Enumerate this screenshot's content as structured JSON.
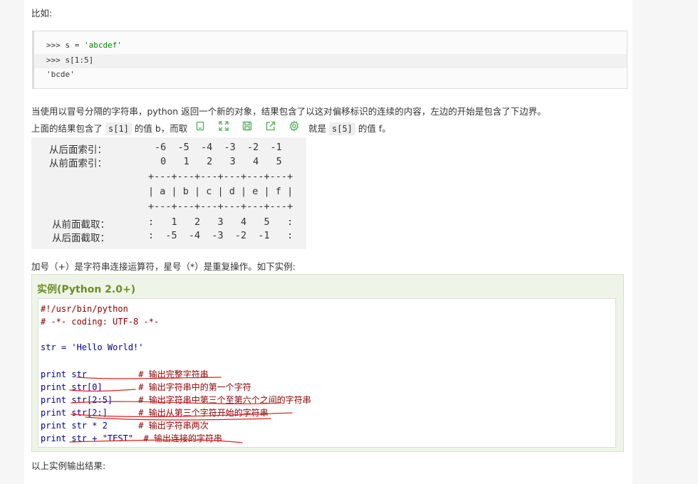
{
  "intro": "比如:",
  "repl": {
    "line1_prompt": ">>> ",
    "line1_code_pre": "s = ",
    "line1_code_str": "'abcdef'",
    "line2": ">>> s[1:5]",
    "line3": "'bcde'"
  },
  "para1": "当使用以冒号分隔的字符串，python 返回一个新的对象，结果包含了以这对偏移标识的连续的内容，左边的开始是包含了下边界。",
  "para2": {
    "part1": "上面的结果包含了",
    "code1": "s[1]",
    "part2": "的值 b，而取",
    "part3": "就是",
    "code2": "s[5]",
    "part4": "的值 f。"
  },
  "toolbar": {
    "icons": [
      "copy-icon",
      "fullscreen-icon",
      "save-icon",
      "share-icon",
      "settings-icon"
    ]
  },
  "diagram": {
    "label_back_index": "从后面索引：",
    "label_front_index": "从前面索引：",
    "label_front_slice": "从前面截取：",
    "label_back_slice": "从后面截取：",
    "back_index": "-6  -5  -4  -3  -2  -1",
    "front_index": " 0   1   2   3   4   5",
    "border1": "+---+---+---+---+---+---+",
    "cells": "| a | b | c | d | e | f |",
    "border2": "+---+---+---+---+---+---+",
    "front_slice": ":   1   2   3   4   5   :",
    "back_slice": ":  -5  -4  -3  -2  -1   :"
  },
  "para3": "加号（+）是字符串连接运算符，星号（*）是重复操作。如下实例:",
  "example": {
    "title": "实例(Python 2.0+)",
    "lines": [
      {
        "code": "#!/usr/bin/python",
        "comment": ""
      },
      {
        "code": "# -*- coding: UTF-8 -*-",
        "comment": ""
      },
      {
        "code": "",
        "comment": ""
      },
      {
        "code": "str = 'Hello World!'",
        "comment": ""
      },
      {
        "code": "",
        "comment": ""
      },
      {
        "code": "print str          ",
        "comment": "# 输出完整字符串"
      },
      {
        "code": "print str[0]       ",
        "comment": "# 输出字符串中的第一个字符"
      },
      {
        "code": "print str[2:5]     ",
        "comment": "# 输出字符串中第三个至第六个之间的字符串"
      },
      {
        "code": "print str[2:]      ",
        "comment": "# 输出从第三个字符开始的字符串"
      },
      {
        "code": "print str * 2      ",
        "comment": "# 输出字符串两次"
      },
      {
        "code": "print str + \"TEST\"  ",
        "comment": "# 输出连接的字符串"
      }
    ]
  },
  "para4": "以上实例输出结果:",
  "colors": {
    "accent_green": "#4caf50",
    "example_title": "#6b8e23",
    "annotation_red": "#e02020"
  }
}
